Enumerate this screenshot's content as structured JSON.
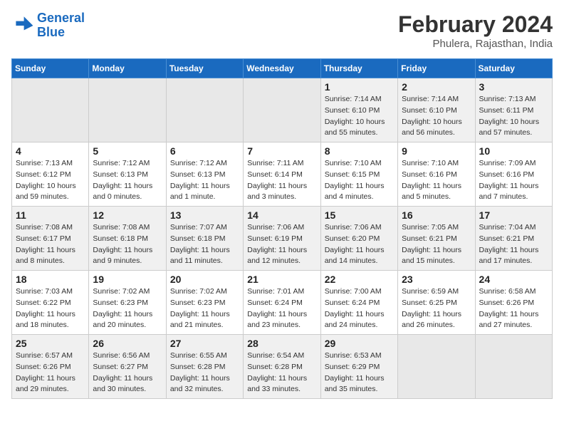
{
  "header": {
    "logo_line1": "General",
    "logo_line2": "Blue",
    "month_year": "February 2024",
    "location": "Phulera, Rajasthan, India"
  },
  "days_of_week": [
    "Sunday",
    "Monday",
    "Tuesday",
    "Wednesday",
    "Thursday",
    "Friday",
    "Saturday"
  ],
  "weeks": [
    [
      {
        "day": "",
        "info": ""
      },
      {
        "day": "",
        "info": ""
      },
      {
        "day": "",
        "info": ""
      },
      {
        "day": "",
        "info": ""
      },
      {
        "day": "1",
        "info": "Sunrise: 7:14 AM\nSunset: 6:10 PM\nDaylight: 10 hours\nand 55 minutes."
      },
      {
        "day": "2",
        "info": "Sunrise: 7:14 AM\nSunset: 6:10 PM\nDaylight: 10 hours\nand 56 minutes."
      },
      {
        "day": "3",
        "info": "Sunrise: 7:13 AM\nSunset: 6:11 PM\nDaylight: 10 hours\nand 57 minutes."
      }
    ],
    [
      {
        "day": "4",
        "info": "Sunrise: 7:13 AM\nSunset: 6:12 PM\nDaylight: 10 hours\nand 59 minutes."
      },
      {
        "day": "5",
        "info": "Sunrise: 7:12 AM\nSunset: 6:13 PM\nDaylight: 11 hours\nand 0 minutes."
      },
      {
        "day": "6",
        "info": "Sunrise: 7:12 AM\nSunset: 6:13 PM\nDaylight: 11 hours\nand 1 minute."
      },
      {
        "day": "7",
        "info": "Sunrise: 7:11 AM\nSunset: 6:14 PM\nDaylight: 11 hours\nand 3 minutes."
      },
      {
        "day": "8",
        "info": "Sunrise: 7:10 AM\nSunset: 6:15 PM\nDaylight: 11 hours\nand 4 minutes."
      },
      {
        "day": "9",
        "info": "Sunrise: 7:10 AM\nSunset: 6:16 PM\nDaylight: 11 hours\nand 5 minutes."
      },
      {
        "day": "10",
        "info": "Sunrise: 7:09 AM\nSunset: 6:16 PM\nDaylight: 11 hours\nand 7 minutes."
      }
    ],
    [
      {
        "day": "11",
        "info": "Sunrise: 7:08 AM\nSunset: 6:17 PM\nDaylight: 11 hours\nand 8 minutes."
      },
      {
        "day": "12",
        "info": "Sunrise: 7:08 AM\nSunset: 6:18 PM\nDaylight: 11 hours\nand 9 minutes."
      },
      {
        "day": "13",
        "info": "Sunrise: 7:07 AM\nSunset: 6:18 PM\nDaylight: 11 hours\nand 11 minutes."
      },
      {
        "day": "14",
        "info": "Sunrise: 7:06 AM\nSunset: 6:19 PM\nDaylight: 11 hours\nand 12 minutes."
      },
      {
        "day": "15",
        "info": "Sunrise: 7:06 AM\nSunset: 6:20 PM\nDaylight: 11 hours\nand 14 minutes."
      },
      {
        "day": "16",
        "info": "Sunrise: 7:05 AM\nSunset: 6:21 PM\nDaylight: 11 hours\nand 15 minutes."
      },
      {
        "day": "17",
        "info": "Sunrise: 7:04 AM\nSunset: 6:21 PM\nDaylight: 11 hours\nand 17 minutes."
      }
    ],
    [
      {
        "day": "18",
        "info": "Sunrise: 7:03 AM\nSunset: 6:22 PM\nDaylight: 11 hours\nand 18 minutes."
      },
      {
        "day": "19",
        "info": "Sunrise: 7:02 AM\nSunset: 6:23 PM\nDaylight: 11 hours\nand 20 minutes."
      },
      {
        "day": "20",
        "info": "Sunrise: 7:02 AM\nSunset: 6:23 PM\nDaylight: 11 hours\nand 21 minutes."
      },
      {
        "day": "21",
        "info": "Sunrise: 7:01 AM\nSunset: 6:24 PM\nDaylight: 11 hours\nand 23 minutes."
      },
      {
        "day": "22",
        "info": "Sunrise: 7:00 AM\nSunset: 6:24 PM\nDaylight: 11 hours\nand 24 minutes."
      },
      {
        "day": "23",
        "info": "Sunrise: 6:59 AM\nSunset: 6:25 PM\nDaylight: 11 hours\nand 26 minutes."
      },
      {
        "day": "24",
        "info": "Sunrise: 6:58 AM\nSunset: 6:26 PM\nDaylight: 11 hours\nand 27 minutes."
      }
    ],
    [
      {
        "day": "25",
        "info": "Sunrise: 6:57 AM\nSunset: 6:26 PM\nDaylight: 11 hours\nand 29 minutes."
      },
      {
        "day": "26",
        "info": "Sunrise: 6:56 AM\nSunset: 6:27 PM\nDaylight: 11 hours\nand 30 minutes."
      },
      {
        "day": "27",
        "info": "Sunrise: 6:55 AM\nSunset: 6:28 PM\nDaylight: 11 hours\nand 32 minutes."
      },
      {
        "day": "28",
        "info": "Sunrise: 6:54 AM\nSunset: 6:28 PM\nDaylight: 11 hours\nand 33 minutes."
      },
      {
        "day": "29",
        "info": "Sunrise: 6:53 AM\nSunset: 6:29 PM\nDaylight: 11 hours\nand 35 minutes."
      },
      {
        "day": "",
        "info": ""
      },
      {
        "day": "",
        "info": ""
      }
    ]
  ]
}
